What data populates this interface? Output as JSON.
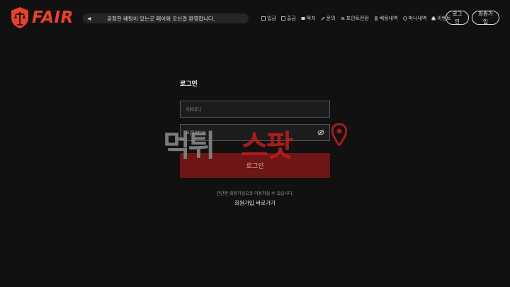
{
  "header": {
    "logo_text": "FAIR",
    "notice": "공정한 배팅이 있는곳 페어에 오신걸 환영합니다.",
    "nav": [
      {
        "label": "입금",
        "icon": "deposit-icon"
      },
      {
        "label": "출금",
        "icon": "withdraw-icon"
      },
      {
        "label": "쪽지",
        "icon": "message-icon"
      },
      {
        "label": "문의",
        "icon": "inquiry-icon"
      },
      {
        "label": "포인트전환",
        "icon": "point-icon"
      },
      {
        "label": "배팅내역",
        "icon": "history-icon"
      },
      {
        "label": "머니내역",
        "icon": "money-icon"
      },
      {
        "label": "이벤트",
        "icon": "event-icon"
      }
    ],
    "login_label": "로그인",
    "signup_label": "회원가입"
  },
  "login": {
    "title": "로그인",
    "id_placeholder": "아이디",
    "pw_placeholder": "비밀번호",
    "submit_label": "로그인",
    "help_text": "간단한 회원가입으로 이용하실 수 있습니다.",
    "signup_link": "회원가입 바로가기"
  },
  "watermark": {
    "left_text": "먹튀",
    "right_text": "스팟"
  },
  "colors": {
    "background": "#111111",
    "brand": "#e8432a",
    "submit": "#6e1616",
    "watermark_red": "#c21d1d"
  }
}
